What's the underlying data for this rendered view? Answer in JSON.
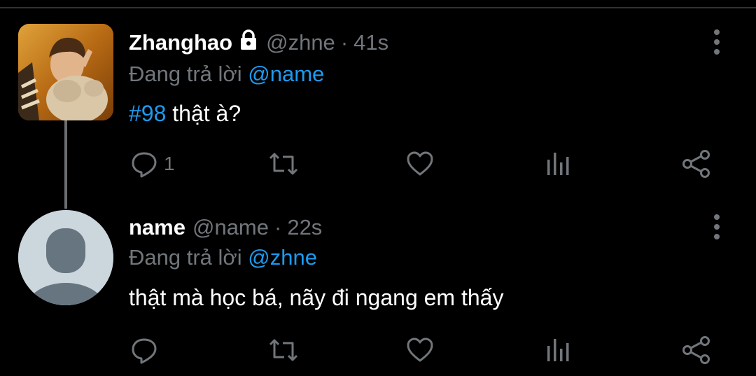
{
  "tweets": [
    {
      "name": "Zhanghao",
      "handle": "@zhne",
      "sep": "·",
      "time": "41s",
      "reply_prefix": "Đang trả lời",
      "reply_to": "@name",
      "hashtag": "#98",
      "text": "thật à?",
      "reply_count": "1",
      "protected": true
    },
    {
      "name": "name",
      "handle": "@name",
      "sep": "·",
      "time": "22s",
      "reply_prefix": "Đang trả lời",
      "reply_to": "@zhne",
      "text": "thật mà học bá, nãy đi ngang em thấy",
      "reply_count": ""
    }
  ],
  "icons": {
    "reply": "reply-icon",
    "retweet": "retweet-icon",
    "like": "like-icon",
    "views": "views-icon",
    "share": "share-icon",
    "more": "more-icon",
    "lock": "lock-icon"
  },
  "colors": {
    "background": "#000000",
    "accent": "#1d9bf0",
    "secondary_text": "#71767b",
    "primary_text": "#ffffff"
  }
}
